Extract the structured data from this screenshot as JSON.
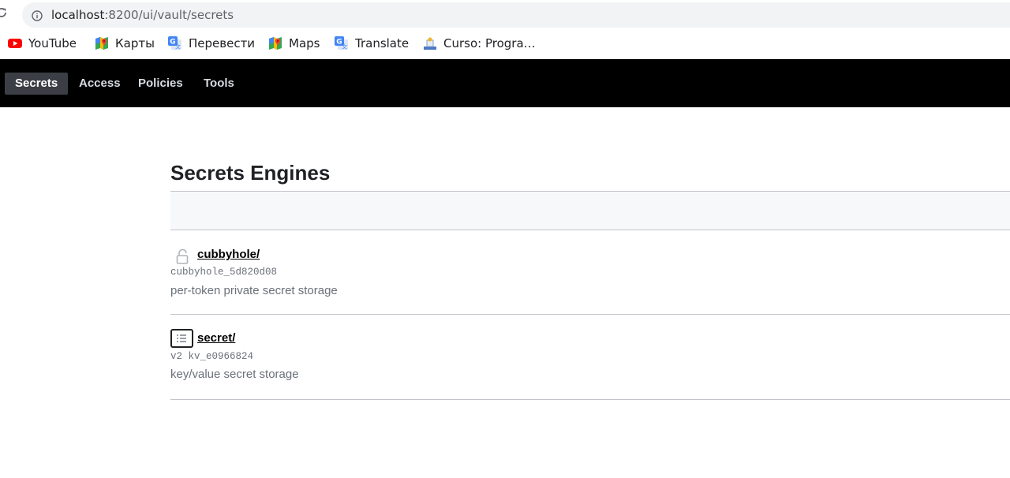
{
  "browser": {
    "url_host": "localhost",
    "url_rest": ":8200/ui/vault/secrets",
    "bookmarks": [
      {
        "label": "YouTube",
        "icon": "youtube-icon"
      },
      {
        "label": "Карты",
        "icon": "google-maps-icon"
      },
      {
        "label": "Перевести",
        "icon": "google-translate-icon"
      },
      {
        "label": "Maps",
        "icon": "google-maps-icon"
      },
      {
        "label": "Translate",
        "icon": "google-translate-icon"
      },
      {
        "label": "Curso: Progra…",
        "icon": "course-icon"
      }
    ]
  },
  "nav": {
    "items": [
      {
        "label": "Secrets",
        "active": true
      },
      {
        "label": "Access",
        "active": false
      },
      {
        "label": "Policies",
        "active": false
      },
      {
        "label": "Tools",
        "active": false
      }
    ]
  },
  "main": {
    "title": "Secrets Engines",
    "engines": [
      {
        "path": "cubbyhole/",
        "meta": "cubbyhole_5d820d08",
        "description": "per-token private secret storage",
        "icon": "lock-icon"
      },
      {
        "path": "secret/",
        "meta": "v2 kv_e0966824",
        "description": "key/value secret storage",
        "icon": "kv-list-icon"
      }
    ]
  },
  "colors": {
    "nav_background": "#000000",
    "nav_active": "#3b3f45",
    "divider": "#c2c5cb",
    "muted_text": "#6b7079"
  }
}
